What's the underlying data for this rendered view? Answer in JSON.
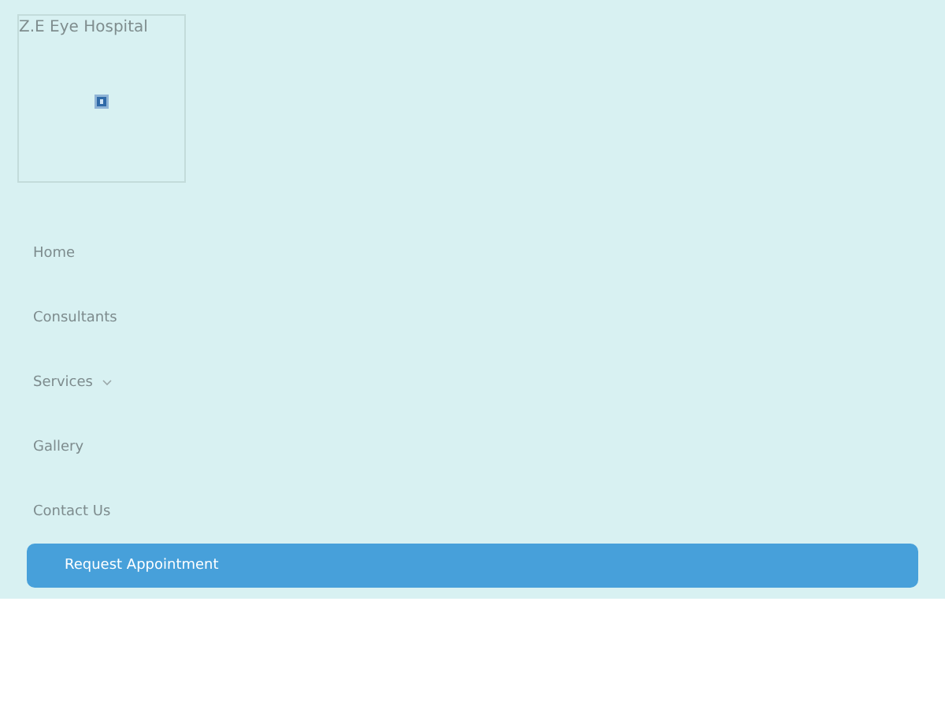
{
  "logo": {
    "alt_text": "Z.E Eye Hospital"
  },
  "nav": {
    "items": [
      {
        "label": "Home",
        "dropdown": false
      },
      {
        "label": "Consultants",
        "dropdown": false
      },
      {
        "label": "Services",
        "dropdown": true
      },
      {
        "label": "Gallery",
        "dropdown": false
      },
      {
        "label": "Contact Us",
        "dropdown": false
      }
    ]
  },
  "cta": {
    "label": "Request Appointment"
  }
}
